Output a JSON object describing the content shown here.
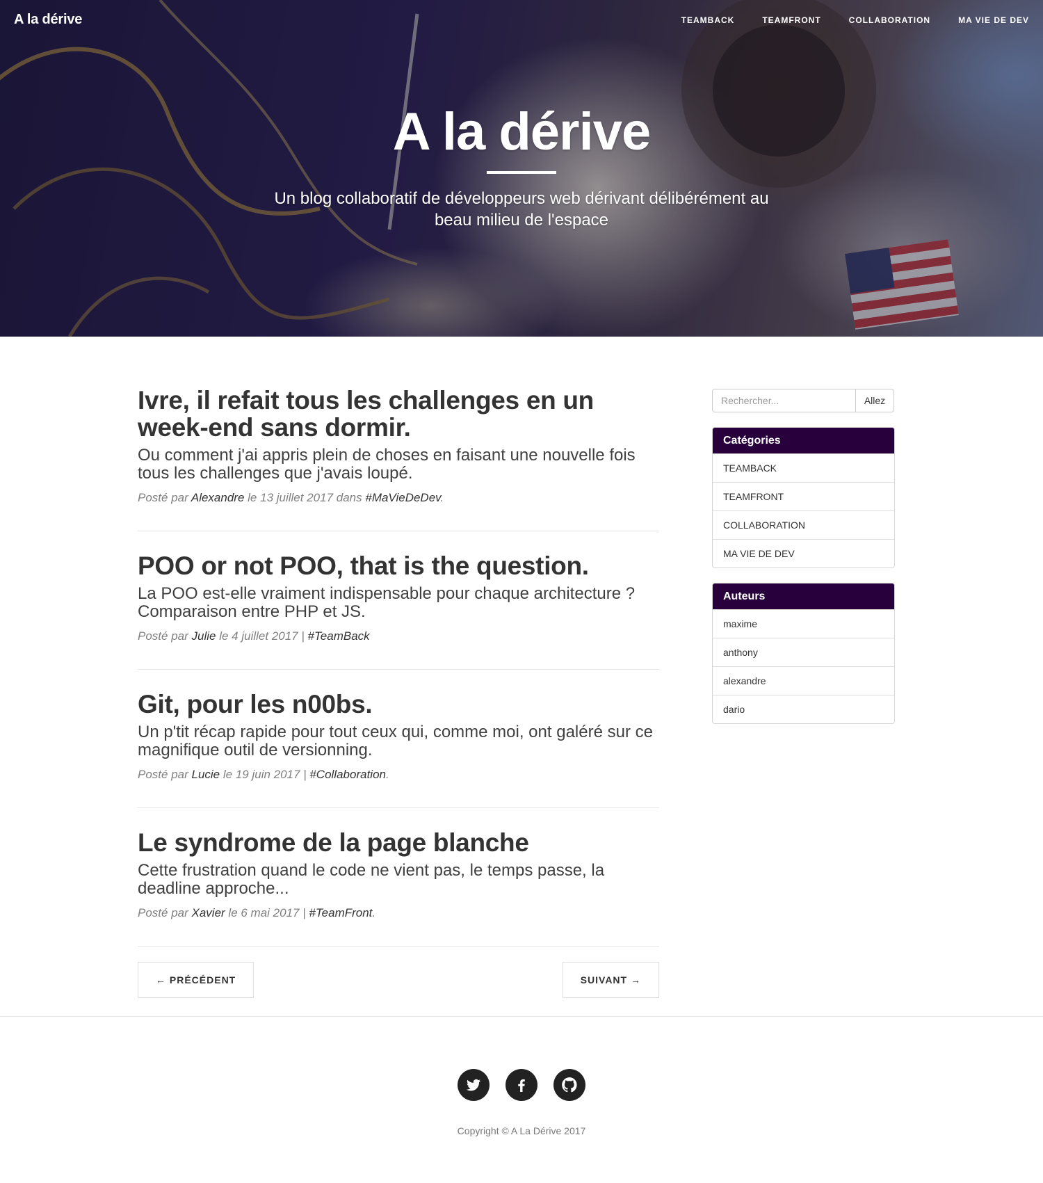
{
  "nav": {
    "brand": "A la dérive",
    "links": [
      "TEAMBACK",
      "TEAMFRONT",
      "COLLABORATION",
      "MA VIE DE DEV"
    ]
  },
  "hero": {
    "title": "A la dérive",
    "subtitle": "Un blog collaboratif de développeurs web dérivant délibérément au beau milieu de l'espace"
  },
  "posts": [
    {
      "title": "Ivre, il refait tous les challenges en un week-end sans dormir.",
      "subtitle": "Ou comment j'ai appris plein de choses en faisant une nouvelle fois tous les challenges que j'avais loupé.",
      "posted_by": "Posté par",
      "author": "Alexandre",
      "date_text": "le 13 juillet 2017 dans",
      "tag": "#MaVieDeDev",
      "end": "."
    },
    {
      "title": "POO or not POO, that is the question.",
      "subtitle": "La POO est-elle vraiment indispensable pour chaque architecture ? Comparaison entre PHP et JS.",
      "posted_by": "Posté par",
      "author": "Julie",
      "date_text": "le 4 juillet 2017 |",
      "tag": "#TeamBack",
      "end": ""
    },
    {
      "title": "Git, pour les n00bs.",
      "subtitle": "Un p'tit récap rapide pour tout ceux qui, comme moi, ont galéré sur ce magnifique outil de versionning.",
      "posted_by": "Posté par",
      "author": "Lucie",
      "date_text": "le 19 juin 2017 |",
      "tag": "#Collaboration",
      "end": "."
    },
    {
      "title": "Le syndrome de la page blanche",
      "subtitle": "Cette frustration quand le code ne vient pas, le temps passe, la deadline approche...",
      "posted_by": "Posté par",
      "author": "Xavier",
      "date_text": "le 6 mai 2017 |",
      "tag": "#TeamFront",
      "end": "."
    }
  ],
  "pager": {
    "prev": "← PRÉCÉDENT",
    "next": "SUIVANT →"
  },
  "sidebar": {
    "search_placeholder": "Rechercher...",
    "search_button": "Allez",
    "categories_title": "Catégories",
    "categories": [
      "TEAMBACK",
      "TEAMFRONT",
      "COLLABORATION",
      "MA VIE DE DEV"
    ],
    "authors_title": "Auteurs",
    "authors": [
      "maxime",
      "anthony",
      "alexandre",
      "dario"
    ]
  },
  "footer": {
    "social": [
      "twitter-icon",
      "facebook-icon",
      "github-icon"
    ],
    "copyright": "Copyright © A La Dérive 2017"
  },
  "colors": {
    "panel_heading": "#27003c",
    "text": "#333333",
    "meta": "#808080"
  }
}
